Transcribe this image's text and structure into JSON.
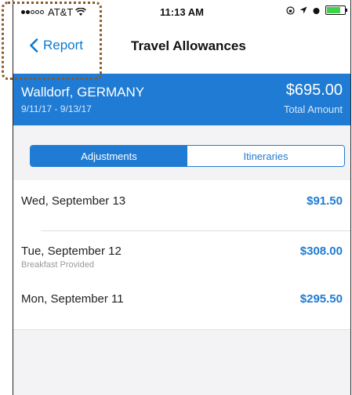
{
  "status_bar": {
    "carrier": "AT&T",
    "time": "11:13 AM"
  },
  "nav": {
    "back_label": "Report",
    "title": "Travel Allowances"
  },
  "header": {
    "location": "Walldorf, GERMANY",
    "dates": "9/11/17 - 9/13/17",
    "amount": "$695.00",
    "amount_label": "Total Amount"
  },
  "segments": {
    "adjustments": "Adjustments",
    "itineraries": "Itineraries",
    "selected": "Adjustments"
  },
  "rows": [
    {
      "date": "Wed, September 13",
      "note": "",
      "amount": "$91.50"
    },
    {
      "date": "Tue, September 12",
      "note": "Breakfast Provided",
      "amount": "$308.00"
    },
    {
      "date": "Mon, September 11",
      "note": "",
      "amount": "$295.50"
    }
  ],
  "colors": {
    "accent": "#1f7bd3",
    "back_link": "#0a7ad0",
    "battery": "#3cd34a",
    "annotation": "#8a5a2a"
  }
}
